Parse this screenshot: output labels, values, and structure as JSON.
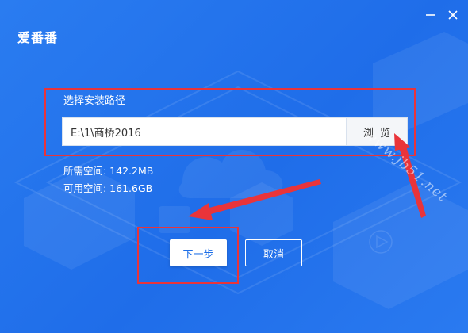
{
  "app": {
    "title": "爱番番"
  },
  "window_controls": {
    "minimize_icon": "minimize-icon",
    "close_icon": "close-icon"
  },
  "install": {
    "path_label": "选择安装路径",
    "path_value": "E:\\1\\商桥2016",
    "browse_label": "浏览",
    "required_space": "所需空间: 142.2MB",
    "available_space": "可用空间: 161.6GB"
  },
  "buttons": {
    "next": "下一步",
    "cancel": "取消"
  },
  "watermark": "www.jb51.net",
  "colors": {
    "background": "#1f6de9",
    "accent": "#1e6fe7",
    "highlight": "#e9343a"
  }
}
